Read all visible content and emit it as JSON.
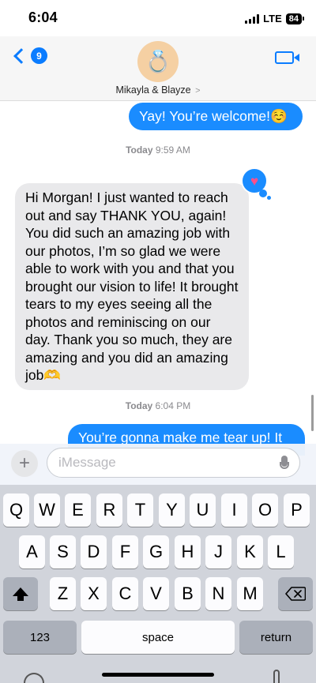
{
  "status_bar": {
    "time": "6:04",
    "network": "LTE",
    "battery": "84"
  },
  "header": {
    "back_badge": "9",
    "avatar_emoji": "💍",
    "contact_name": "Mikayla & Blayze",
    "contact_chevron": ">"
  },
  "messages": {
    "sent_1": "Yay! You’re welcome!☺️",
    "timestamp_1_day": "Today",
    "timestamp_1_time": "9:59 AM",
    "received_1": "Hi Morgan! I just wanted to reach out and say THANK YOU, again! You did such an amazing job with our photos, I’m so glad we were able to work with you and that you brought our vision to life! It brought tears to my eyes seeing all the photos and reminiscing on our day. Thank you so much, they are amazing and you did an amazing job🫶",
    "tapback_emoji": "♥",
    "timestamp_2_day": "Today",
    "timestamp_2_time": "6:04 PM",
    "sent_2": "You’re gonna make me tear up! It"
  },
  "input": {
    "placeholder": "iMessage",
    "plus": "+"
  },
  "keyboard": {
    "row1": [
      "Q",
      "W",
      "E",
      "R",
      "T",
      "Y",
      "U",
      "I",
      "O",
      "P"
    ],
    "row2": [
      "A",
      "S",
      "D",
      "F",
      "G",
      "H",
      "J",
      "K",
      "L"
    ],
    "row3": [
      "Z",
      "X",
      "C",
      "V",
      "B",
      "N",
      "M"
    ],
    "numbers_label": "123",
    "space_label": "space",
    "return_label": "return"
  },
  "colors": {
    "accent": "#0a7cff",
    "sent_bubble": "#1a8cff",
    "received_bubble": "#e9e9eb",
    "keyboard_bg": "#d1d4db"
  },
  "icons": [
    "back-chevron-icon",
    "video-call-icon",
    "plus-icon",
    "microphone-icon",
    "shift-icon",
    "delete-icon"
  ]
}
